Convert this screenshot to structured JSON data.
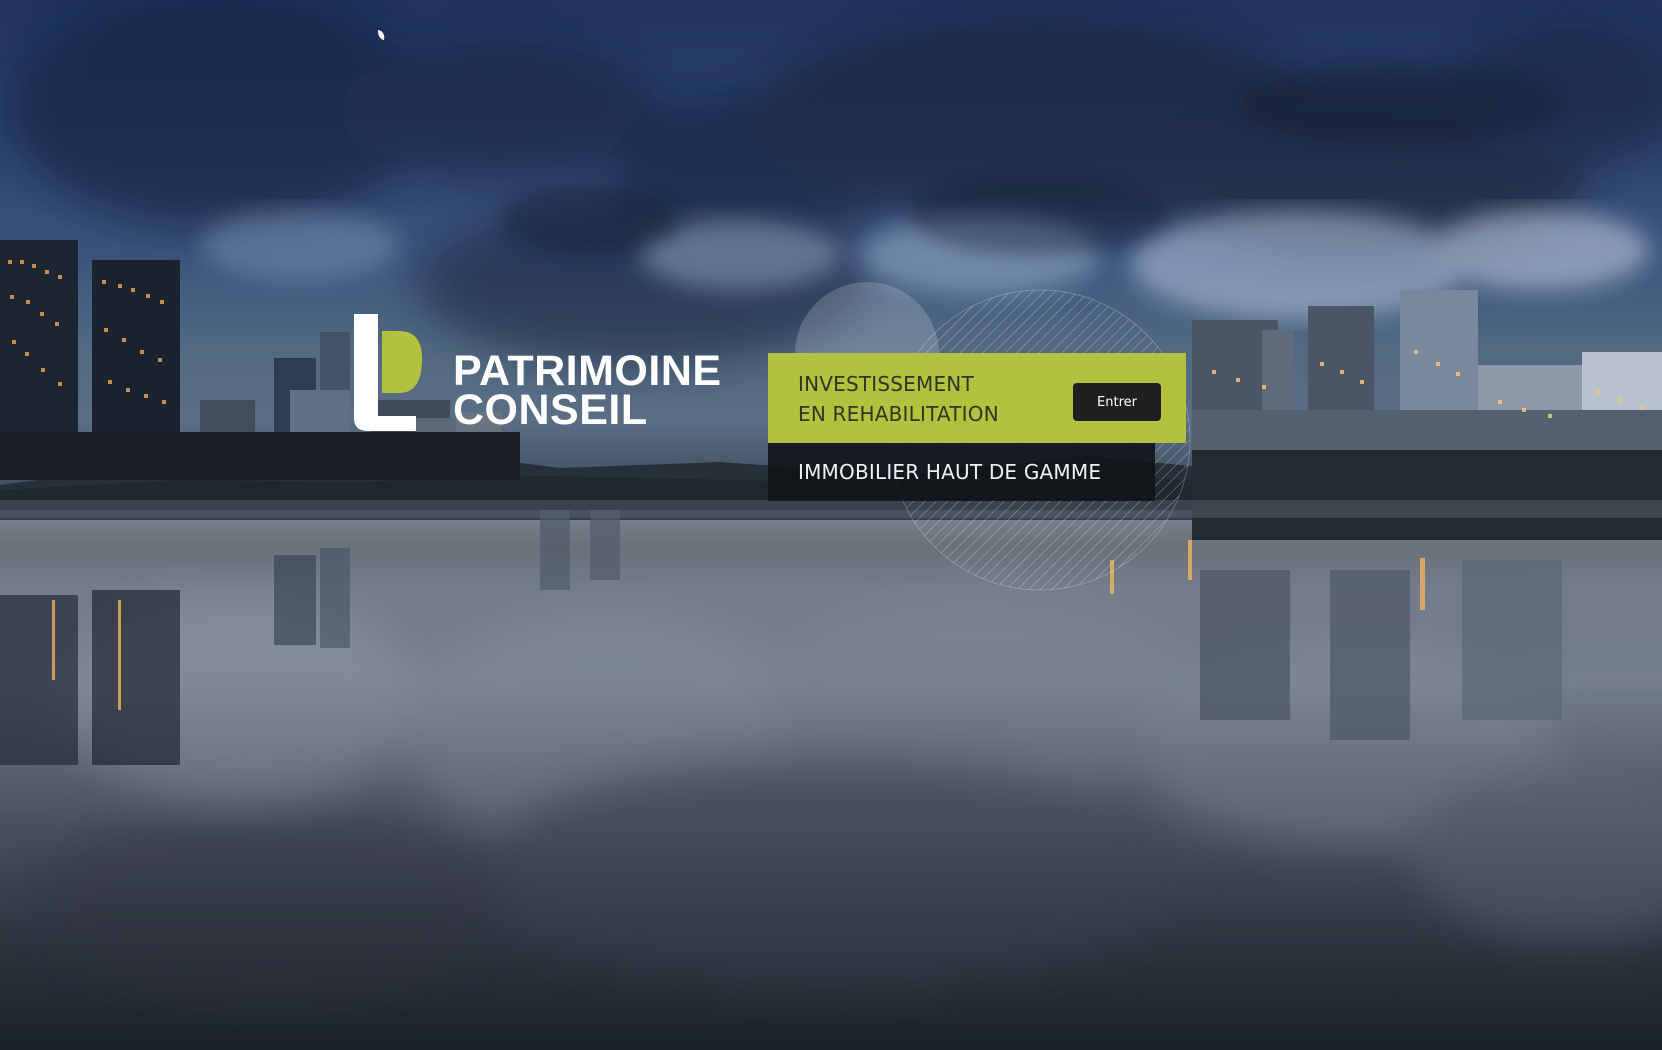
{
  "brand": {
    "line1": "PATRIMOINE",
    "line2": "CONSEIL",
    "accent_color": "#b3c23e",
    "logo_mark_icon": "ld-logo-icon"
  },
  "hero": {
    "background_icon": "cityscape-river-background"
  },
  "panel": {
    "line1": "INVESTISSEMENT",
    "line2": "EN REHABILITATION",
    "button_label": "Entrer"
  },
  "subpanel": {
    "label": "IMMOBILIER HAUT DE GAMME"
  }
}
